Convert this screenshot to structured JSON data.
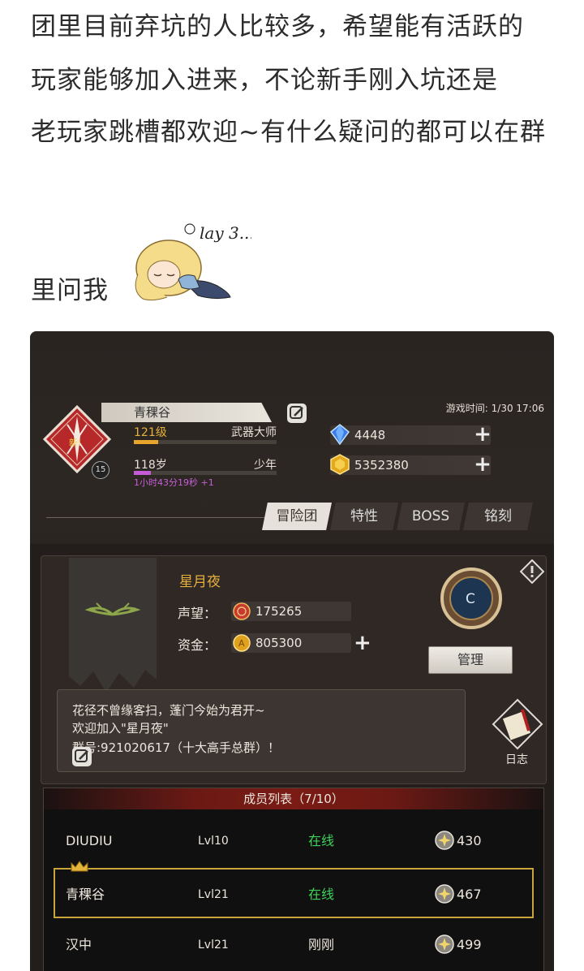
{
  "article": {
    "line1": "团里目前弃坑的人比较多，希望能有活跃的",
    "line2": "玩家能够加入进来，不论新手刚入坑还是",
    "line3": "老玩家跳槽都欢迎~有什么疑问的都可以在群",
    "line4": "里问我",
    "sticker_text": "lay 3..."
  },
  "game": {
    "player": {
      "name": "青稞谷",
      "emblem_text": "新!",
      "emblem_level": "15",
      "level": "121级",
      "title": "武器大师",
      "level_progress": 0.17,
      "age": "118岁",
      "age_stage": "少年",
      "age_progress": 0.12,
      "time_left": "1小时43分19秒 +1"
    },
    "game_time": "游戏时间: 1/30 17:06",
    "resources": {
      "diamonds": "4448",
      "gold": "5352380"
    },
    "tabs": [
      "冒险团",
      "特性",
      "BOSS",
      "铭刻"
    ],
    "guild": {
      "name": "星月夜",
      "reputation_label": "声望：",
      "reputation": "175265",
      "funds_label": "资金：",
      "funds": "805300",
      "crest_letter": "C",
      "manage_label": "管理",
      "notice_line1": "花径不曾缘客扫，蓬门今始为君开~",
      "notice_line2": "欢迎加入\"星月夜\"",
      "notice_line3": "群号:921020617（十大高手总群）！",
      "log_label": "日志"
    },
    "members": {
      "header": "成员列表（7/10）",
      "rows": [
        {
          "name": "DIUDIU",
          "level": "Lvl10",
          "status": "在线",
          "power": "430"
        },
        {
          "name": "青稞谷",
          "level": "Lvl21",
          "status": "在线",
          "power": "467"
        },
        {
          "name": "汉中",
          "level": "Lvl21",
          "status": "刚刚",
          "power": "499"
        }
      ]
    }
  }
}
